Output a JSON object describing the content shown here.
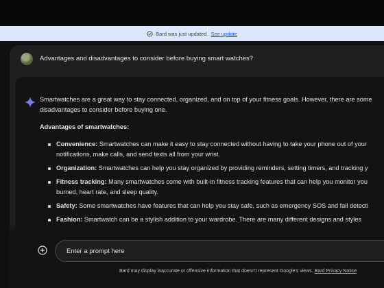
{
  "notice": {
    "text": "Bard was just updated.",
    "link": "See update"
  },
  "prompt": {
    "text": "Advantages and disadvantages to consider before buying smart watches?"
  },
  "response": {
    "intro_line1": "Smartwatches are a great way to stay connected, organized, and on top of your fitness goals. However, there are some",
    "intro_line2": "disadvantages to consider before buying one.",
    "advantages_heading": "Advantages of smartwatches:",
    "items": [
      {
        "term": "Convenience:",
        "line1": " Smartwatches can make it easy to stay connected without having to take your phone out of your",
        "line2": "notifications, make calls, and send texts all from your wrist."
      },
      {
        "term": "Organization:",
        "line1": " Smartwatches can help you stay organized by providing reminders, setting timers, and tracking y",
        "line2": ""
      },
      {
        "term": "Fitness tracking:",
        "line1": " Many smartwatches come with built-in fitness tracking features that can help you monitor you",
        "line2": "burned, heart rate, and sleep quality."
      },
      {
        "term": "Safety:",
        "line1": " Some smartwatches have features that can help you stay safe, such as emergency SOS and fall detecti",
        "line2": ""
      },
      {
        "term": "Fashion:",
        "line1": " Smartwatch can be a stylish addition to your wardrobe. There are many different designs and styles",
        "line2": ""
      }
    ]
  },
  "input": {
    "placeholder": "Enter a prompt here"
  },
  "footer": {
    "disclaimer": "Bard may display inaccurate or offensive information that doesn't represent Google's views.",
    "privacy_link": "Bard Privacy Notice"
  }
}
